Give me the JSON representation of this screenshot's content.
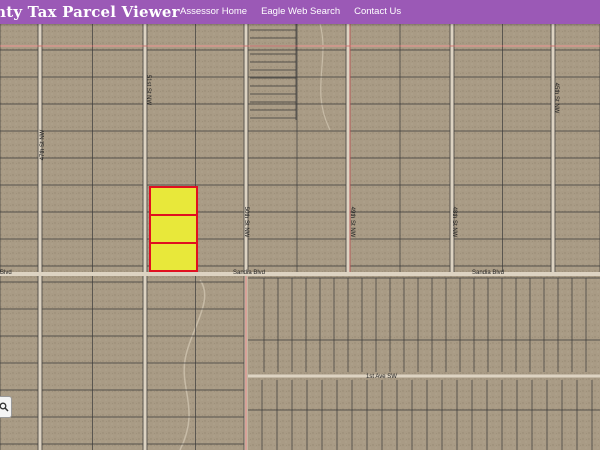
{
  "app": {
    "title": "unty Tax Parcel Viewer",
    "nav": [
      {
        "label": "Assessor Home"
      },
      {
        "label": "Eagle Web Search"
      },
      {
        "label": "Contact Us"
      }
    ]
  },
  "map": {
    "street_labels": {
      "st_47": "47th St NW",
      "st_51": "51st St NW",
      "st_50": "50th St NW",
      "st_49": "49th St NW",
      "st_48": "48th St NW",
      "st_45": "45th St NW",
      "sandia_left": "Blvd",
      "sandia_mid": "Sandia Blvd",
      "sandia_right": "Sandia Blvd",
      "ave_1st": "1st Ave SW"
    },
    "selected_parcels_count": 3,
    "colors": {
      "top_bar": "#9b59b6",
      "parcel_line": "#3a3a3a",
      "road": "#ddd3c2",
      "selection_fill": "#e8e83a",
      "selection_border": "#e01020",
      "boundary_line": "#d05a5a"
    }
  },
  "controls": {
    "zoom_icon": "magnifier-icon"
  }
}
